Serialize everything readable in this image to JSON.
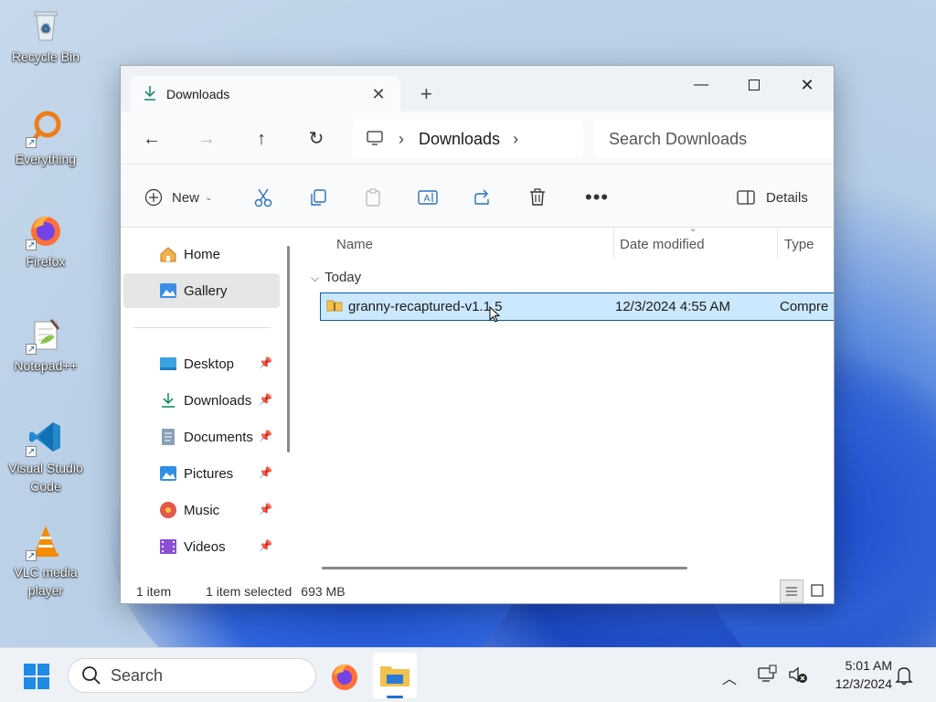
{
  "desktop": {
    "icons": [
      {
        "label": "Recycle Bin"
      },
      {
        "label": "Everything"
      },
      {
        "label": "Firefox"
      },
      {
        "label": "Notepad++"
      },
      {
        "label": "Visual Studio Code"
      },
      {
        "label": "VLC media player"
      }
    ]
  },
  "window": {
    "tab_title": "Downloads",
    "address": {
      "crumb": "Downloads"
    },
    "search_placeholder": "Search Downloads",
    "toolbar": {
      "new_label": "New",
      "details_label": "Details"
    },
    "sidebar": {
      "home": "Home",
      "gallery": "Gallery",
      "pinned": [
        "Desktop",
        "Downloads",
        "Documents",
        "Pictures",
        "Music",
        "Videos"
      ]
    },
    "columns": {
      "name": "Name",
      "date": "Date modified",
      "type": "Type"
    },
    "group_label": "Today",
    "files": [
      {
        "name": "granny-recaptured-v1.1.5",
        "date": "12/3/2024 4:55 AM",
        "type": "Compre"
      }
    ],
    "status": {
      "count": "1 item",
      "selected": "1 item selected",
      "size": "693 MB"
    }
  },
  "taskbar": {
    "search_label": "Search",
    "time": "5:01 AM",
    "date": "12/3/2024"
  },
  "colors": {
    "accent": "#0f5ba8",
    "selection": "#cce8ff"
  }
}
